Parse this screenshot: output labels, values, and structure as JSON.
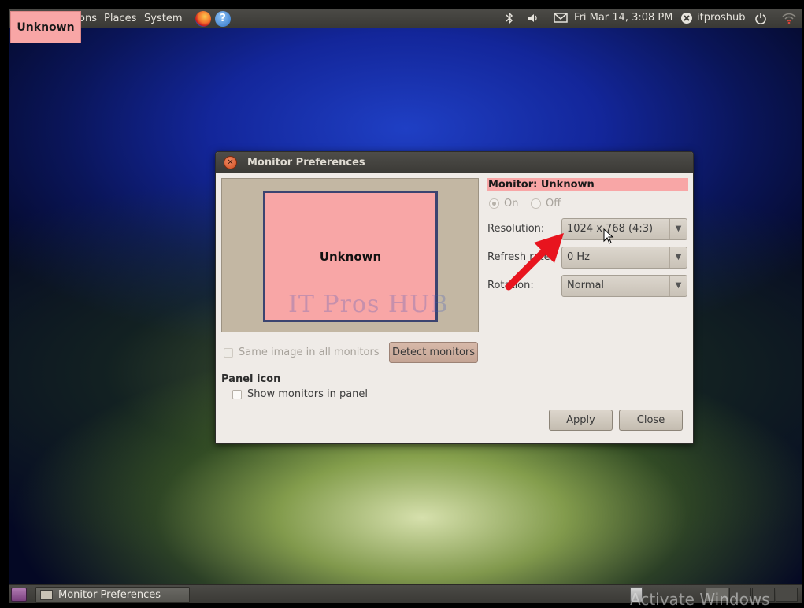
{
  "top_panel": {
    "menus": [
      "ons",
      "Places",
      "System"
    ],
    "datetime": "Fri Mar 14,  3:08 PM",
    "username": "itproshub",
    "bluetooth_icon": "bluetooth-icon",
    "volume_icon": "volume-icon",
    "mail_icon": "mail-icon",
    "power_icon": "power-icon",
    "wifi_icon": "wifi-icon"
  },
  "overlay_label": "Unknown",
  "dialog": {
    "title": "Monitor Preferences",
    "monitor_preview_label": "Unknown",
    "watermark": "IT Pros HUB",
    "monitor_header": "Monitor: Unknown",
    "power": {
      "on": "On",
      "off": "Off",
      "selected": "On"
    },
    "resolution": {
      "label": "Resolution:",
      "value": "1024 x 768 (4:3)"
    },
    "refresh_rate": {
      "label": "Refresh rate:",
      "value": "0 Hz"
    },
    "rotation": {
      "label": "Rotation:",
      "value": "Normal"
    },
    "same_image_label": "Same image in all monitors",
    "detect_button": "Detect monitors",
    "panel_icon_heading": "Panel icon",
    "show_monitors_label": "Show monitors in panel",
    "apply_button": "Apply",
    "close_button": "Close"
  },
  "bottom_panel": {
    "taskbar_item": "Monitor Preferences",
    "activate_windows": "Activate Windows"
  },
  "colors": {
    "highlight_pink": "#f8a6a6",
    "panel_dark": "#3a3935",
    "dialog_bg": "#efebe7",
    "arrow_red": "#e8141e"
  }
}
